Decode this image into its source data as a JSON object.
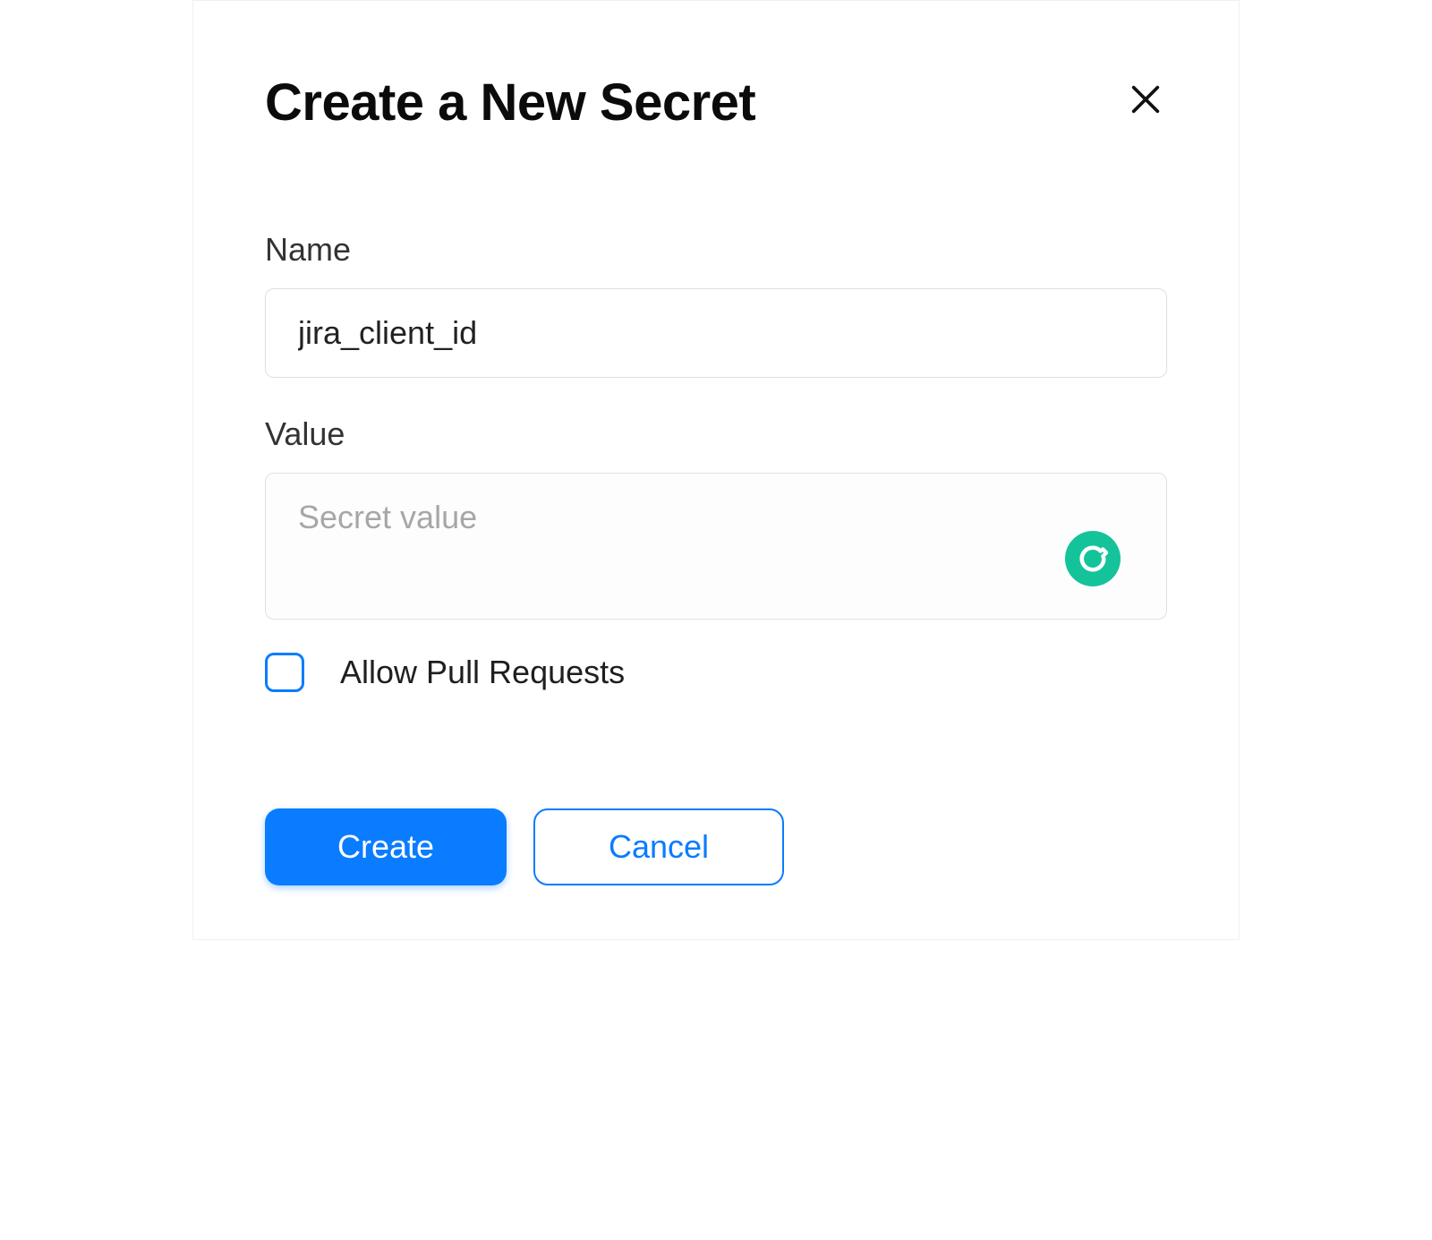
{
  "dialog": {
    "title": "Create a New Secret",
    "name_label": "Name",
    "name_value": "jira_client_id",
    "value_label": "Value",
    "value_placeholder": "Secret value",
    "value_value": "",
    "allow_pr_label": "Allow Pull Requests",
    "allow_pr_checked": false,
    "create_label": "Create",
    "cancel_label": "Cancel"
  },
  "colors": {
    "primary": "#0a7cff",
    "badge": "#15c39a"
  }
}
